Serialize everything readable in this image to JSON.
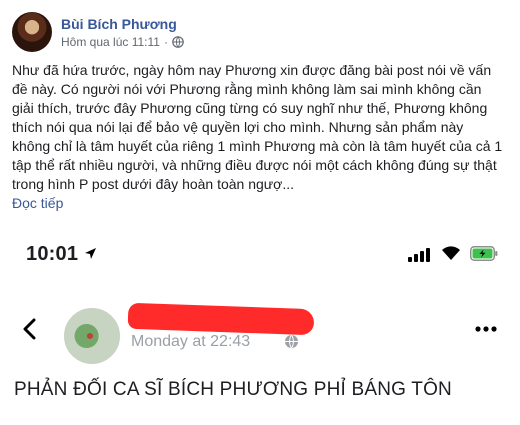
{
  "post": {
    "author": "Bùi Bích Phương",
    "timestamp": "Hôm qua lúc 11:11",
    "separator": "·",
    "audience_icon": "globe-icon",
    "body_lines": [
      "Như đã hứa trước, ngày hôm nay Phương xin được đăng bài post nói về vấn",
      "đề này. Có người nói với Phương rằng mình không làm sai mình không cần",
      "giải thích, trước đây Phương cũng từng có suy nghĩ như thế, Phương không",
      "thích nói qua nói lại để bảo vệ quyền lợi cho mình. Nhưng sản phẩm này",
      "không chỉ là tâm huyết của riêng 1 mình Phương mà còn là tâm huyết của cả 1",
      "tập thể rất nhiều người, và những điều được nói một cách không đúng sự thật",
      "trong hình P post dưới đây hoàn toàn ngượ..."
    ],
    "read_more": "Đọc tiếp"
  },
  "screenshot": {
    "status_time": "10:01",
    "post_time": "Monday at 22:43",
    "post_title": "PHẢN ĐỐI CA SĨ BÍCH PHƯƠNG PHỈ BÁNG TÔN",
    "icons": [
      "location-arrow-icon",
      "signal-icon",
      "wifi-icon",
      "battery-icon",
      "back-icon",
      "globe-icon",
      "more-icon"
    ],
    "colors": {
      "battery_fill": "#3ec04f",
      "redaction": "#ff2a2a"
    }
  }
}
